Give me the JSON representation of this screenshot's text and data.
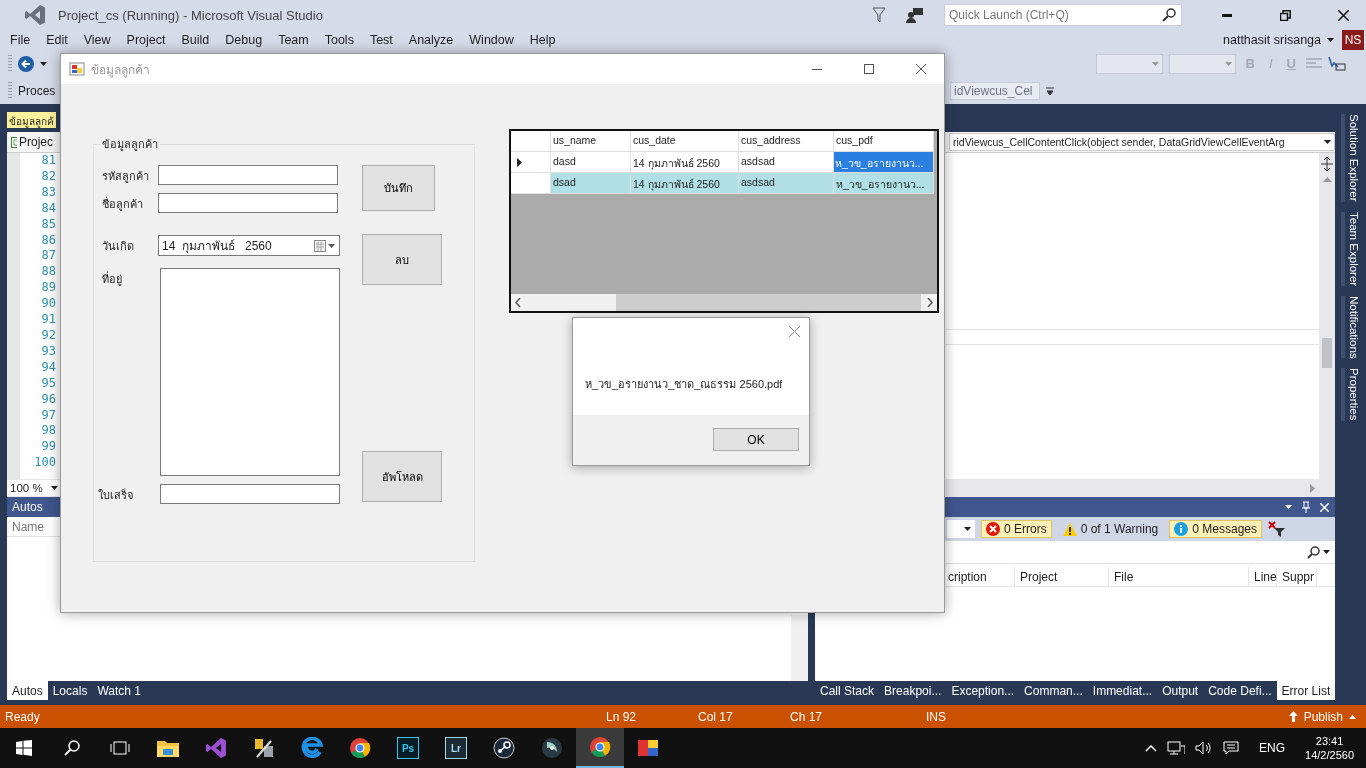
{
  "vs": {
    "title": "Project_cs (Running) - Microsoft Visual Studio",
    "quick_launch": {
      "placeholder": "Quick Launch (Ctrl+Q)"
    },
    "user": "natthasit srisanga",
    "avatar": "NS"
  },
  "menu": [
    "File",
    "Edit",
    "View",
    "Project",
    "Build",
    "Debug",
    "Team",
    "Tools",
    "Test",
    "Analyze",
    "Window",
    "Help"
  ],
  "toolbar": {
    "format_buttons": [
      "B",
      "I",
      "U"
    ],
    "process_label": "Proces",
    "member_dropdown": "idViewcus_Cel"
  },
  "editor": {
    "tab": "ข้อมูลลูกค้",
    "project_dropdown": "Projec",
    "member_dropdown": "ridViewcus_CellContentClick(object sender, DataGridViewCellEventArg",
    "zoom": "100 %",
    "lines": [
      {
        "number": "81",
        "current": false
      },
      {
        "number": "82",
        "current": false
      },
      {
        "number": "83",
        "current": false
      },
      {
        "number": "84",
        "current": false
      },
      {
        "number": "85",
        "current": false
      },
      {
        "number": "86",
        "current": false
      },
      {
        "number": "87",
        "current": false
      },
      {
        "number": "88",
        "current": false
      },
      {
        "number": "89",
        "current": false
      },
      {
        "number": "90",
        "current": false
      },
      {
        "number": "91",
        "current": false
      },
      {
        "number": "92",
        "current": true
      },
      {
        "number": "93",
        "current": false
      },
      {
        "number": "94",
        "current": false
      },
      {
        "number": "95",
        "current": false
      },
      {
        "number": "96",
        "current": false
      },
      {
        "number": "97",
        "current": false
      },
      {
        "number": "98",
        "current": false
      },
      {
        "number": "99",
        "current": false
      },
      {
        "number": "100",
        "current": false
      }
    ]
  },
  "side_tabs": [
    "Solution Explorer",
    "Team Explorer",
    "Notifications",
    "Properties"
  ],
  "autos": {
    "title": "Autos",
    "columns": [
      "Name"
    ],
    "tabs": [
      {
        "label": "Autos",
        "selected": true
      },
      {
        "label": "Locals",
        "selected": false
      },
      {
        "label": "Watch 1",
        "selected": false
      }
    ]
  },
  "error_list": {
    "filters": [
      {
        "kind": "error",
        "label": "0 Errors",
        "on": true
      },
      {
        "kind": "warning",
        "label": "0 of 1 Warning",
        "on": false
      },
      {
        "kind": "message",
        "label": "0 Messages",
        "on": true
      }
    ],
    "columns": [
      "cription",
      "Project",
      "File",
      "Line",
      "Suppr"
    ],
    "tabs": [
      {
        "label": "Call Stack",
        "selected": false
      },
      {
        "label": "Breakpoi...",
        "selected": false
      },
      {
        "label": "Exception...",
        "selected": false
      },
      {
        "label": "Comman...",
        "selected": false
      },
      {
        "label": "Immediat...",
        "selected": false
      },
      {
        "label": "Output",
        "selected": false
      },
      {
        "label": "Code Defi...",
        "selected": false
      },
      {
        "label": "Error List",
        "selected": true
      }
    ]
  },
  "status_bar": {
    "state": "Ready",
    "line": "Ln 92",
    "col": "Col 17",
    "ch": "Ch 17",
    "mode": "INS",
    "publish": "Publish"
  },
  "form": {
    "title": "ข้อมูลลูกค้า",
    "group_title": "ข้อมูลลูกค้า",
    "code_label": "รหัสลูกค้า",
    "name_label": "ชื่อลูกค้า",
    "date_label": "วันเกิด",
    "date_value": "14  กุมภาพันธ์   2560",
    "address_label": "ที่อยู่",
    "receipt_label": "ใบเสร็จ",
    "buttons": [
      "บันทึก",
      "ลบ",
      "อัพโหลด"
    ],
    "grid": {
      "columns": [
        "us_name",
        "cus_date",
        "cus_address",
        "cus_pdf"
      ],
      "rows": [
        {
          "current": true,
          "selected": false,
          "cells": [
            {
              "text": "dasd",
              "selected": false
            },
            {
              "text": "14 กุมภาพันธ์ 2560",
              "selected": false
            },
            {
              "text": "asdsad",
              "selected": false
            },
            {
              "text": "ห_วข_อรายงานว...",
              "selected": true
            }
          ]
        },
        {
          "current": false,
          "selected": true,
          "cells": [
            {
              "text": "dsad",
              "selected": false
            },
            {
              "text": "14 กุมภาพันธ์ 2560",
              "selected": false
            },
            {
              "text": "asdsad",
              "selected": false
            },
            {
              "text": "ห_วข_อรายงานว...",
              "selected": false
            }
          ]
        }
      ]
    }
  },
  "message_box": {
    "message": "ห_วข_อรายงานว_ชาด_ณธรรม 2560.pdf",
    "button": "OK"
  },
  "taskbar": {
    "apps": [
      {
        "kind": "start",
        "selected": false
      },
      {
        "kind": "search",
        "selected": false
      },
      {
        "kind": "task-view",
        "selected": false
      },
      {
        "kind": "folder",
        "selected": false
      },
      {
        "kind": "vs",
        "selected": false
      },
      {
        "kind": "tool",
        "selected": false
      },
      {
        "kind": "edge",
        "selected": false
      },
      {
        "kind": "chrome",
        "selected": false
      },
      {
        "kind": "ps",
        "label": "Ps",
        "selected": false
      },
      {
        "kind": "lr",
        "label": "Lr",
        "selected": false
      },
      {
        "kind": "steam",
        "selected": false
      },
      {
        "kind": "media",
        "selected": false
      },
      {
        "kind": "chrome",
        "selected": true
      },
      {
        "kind": "app",
        "selected": false
      }
    ],
    "language": "ENG",
    "time": "23:41",
    "date": "14/2/2560"
  }
}
